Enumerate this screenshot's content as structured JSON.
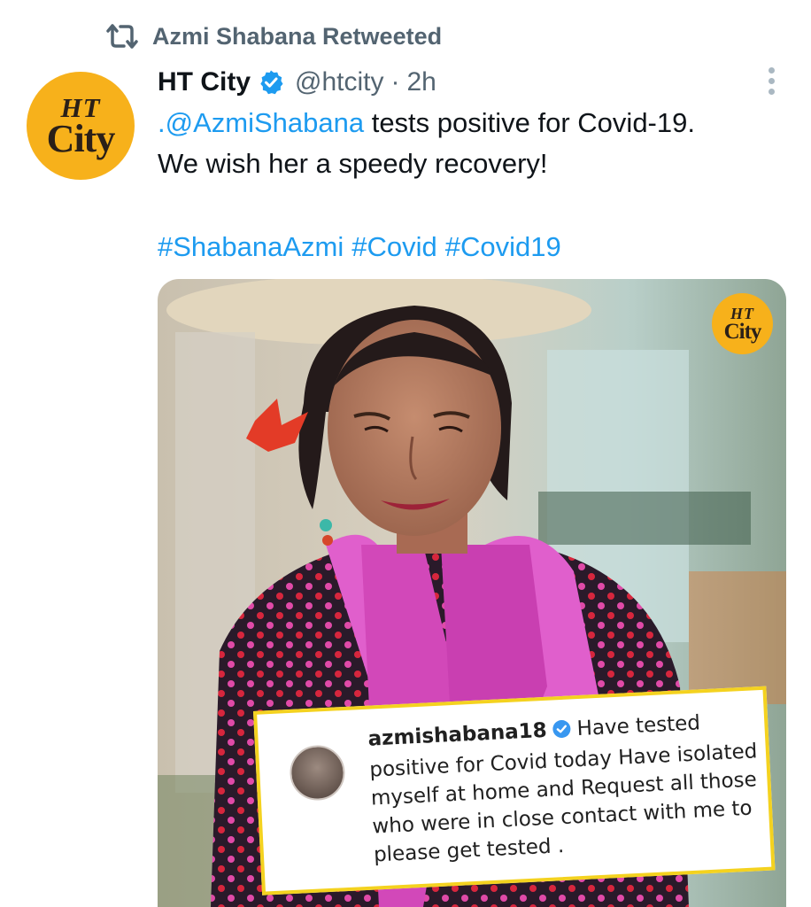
{
  "retweet": {
    "label": "Azmi Shabana Retweeted"
  },
  "tweet": {
    "avatar_logo_top": "HT",
    "avatar_logo_bottom": "City",
    "display_name": "HT City",
    "handle": "@htcity",
    "dot": "·",
    "time": "2h",
    "line1_mention": ".@AzmiShabana",
    "line1_rest": " tests positive for Covid-19.",
    "line2": "We wish her a speedy recovery!",
    "hashtags": [
      "#ShabanaAzmi",
      "#Covid",
      "#Covid19"
    ]
  },
  "media": {
    "logo_top": "HT",
    "logo_bottom": "City",
    "instagram_card": {
      "username": "azmishabana18",
      "caption": "Have tested positive for Covid today Have isolated myself at home and Request all those who were in close contact with me  to please get tested ."
    }
  },
  "colors": {
    "link_blue": "#1d9bf0",
    "secondary_gray": "#536471",
    "ht_city_yellow": "#f7b11b",
    "verified_blue": "#1d9bf0",
    "card_border_yellow": "#f4d21f"
  },
  "icons": [
    "retweet-icon",
    "verified-icon",
    "more-icon"
  ]
}
